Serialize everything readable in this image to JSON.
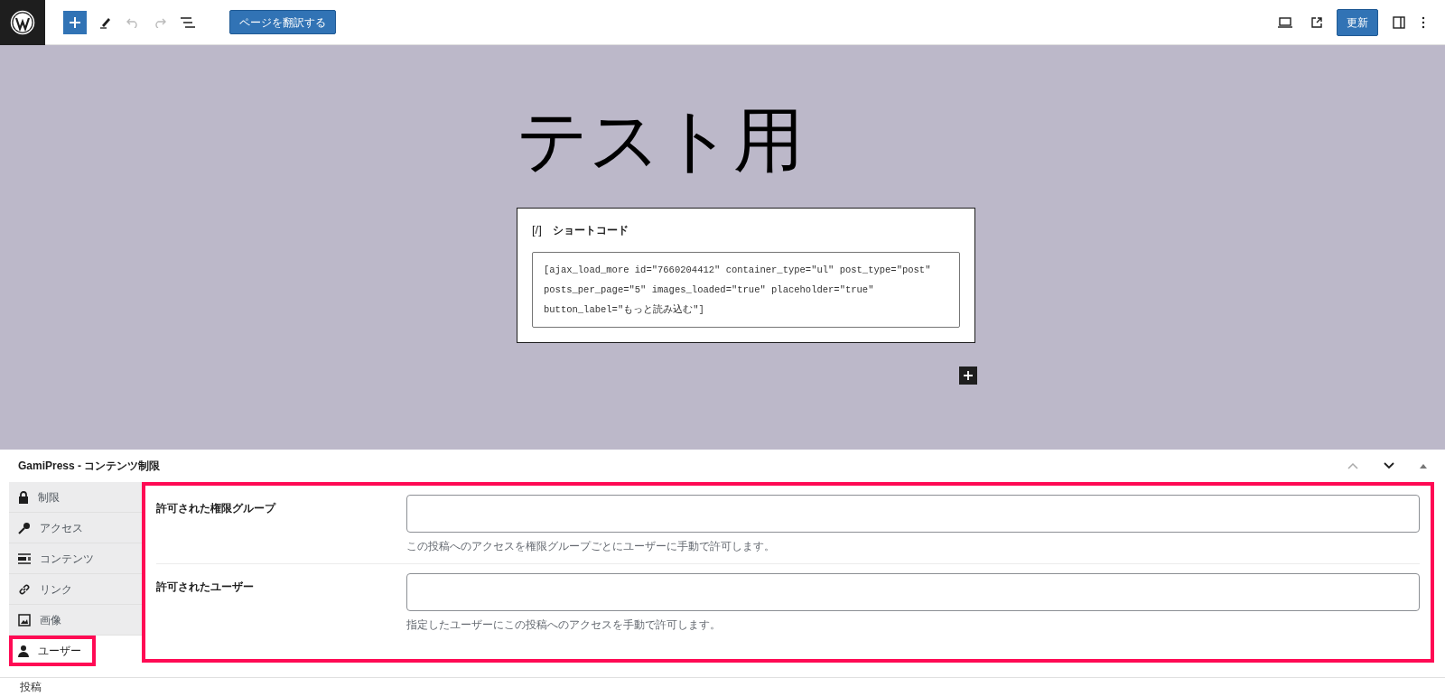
{
  "toolbar": {
    "translate_button": "ページを翻訳する",
    "update_button": "更新"
  },
  "post": {
    "title": "テスト用",
    "block": {
      "icon": "[/]",
      "label": "ショートコード",
      "code": "[ajax_load_more id=\"7660204412\" container_type=\"ul\" post_type=\"post\" posts_per_page=\"5\" images_loaded=\"true\" placeholder=\"true\" button_label=\"もっと読み込む\"]"
    }
  },
  "meta_box": {
    "title": "GamiPress - コンテンツ制限",
    "tabs": [
      {
        "label": "制限",
        "kind": "lock",
        "selected": false,
        "highlighted": false
      },
      {
        "label": "アクセス",
        "kind": "key",
        "selected": false,
        "highlighted": false
      },
      {
        "label": "コンテンツ",
        "kind": "content",
        "selected": false,
        "highlighted": false
      },
      {
        "label": "リンク",
        "kind": "link",
        "selected": false,
        "highlighted": false
      },
      {
        "label": "画像",
        "kind": "image",
        "selected": false,
        "highlighted": false
      },
      {
        "label": "ユーザー",
        "kind": "user",
        "selected": true,
        "highlighted": true
      }
    ],
    "fields_highlighted": true,
    "fields": [
      {
        "label": "許可された権限グループ",
        "help": "この投稿へのアクセスを権限グループごとにユーザーに手動で許可します。"
      },
      {
        "label": "許可されたユーザー",
        "help": "指定したユーザーにこの投稿へのアクセスを手動で許可します。"
      }
    ]
  },
  "breadcrumb": "投稿"
}
